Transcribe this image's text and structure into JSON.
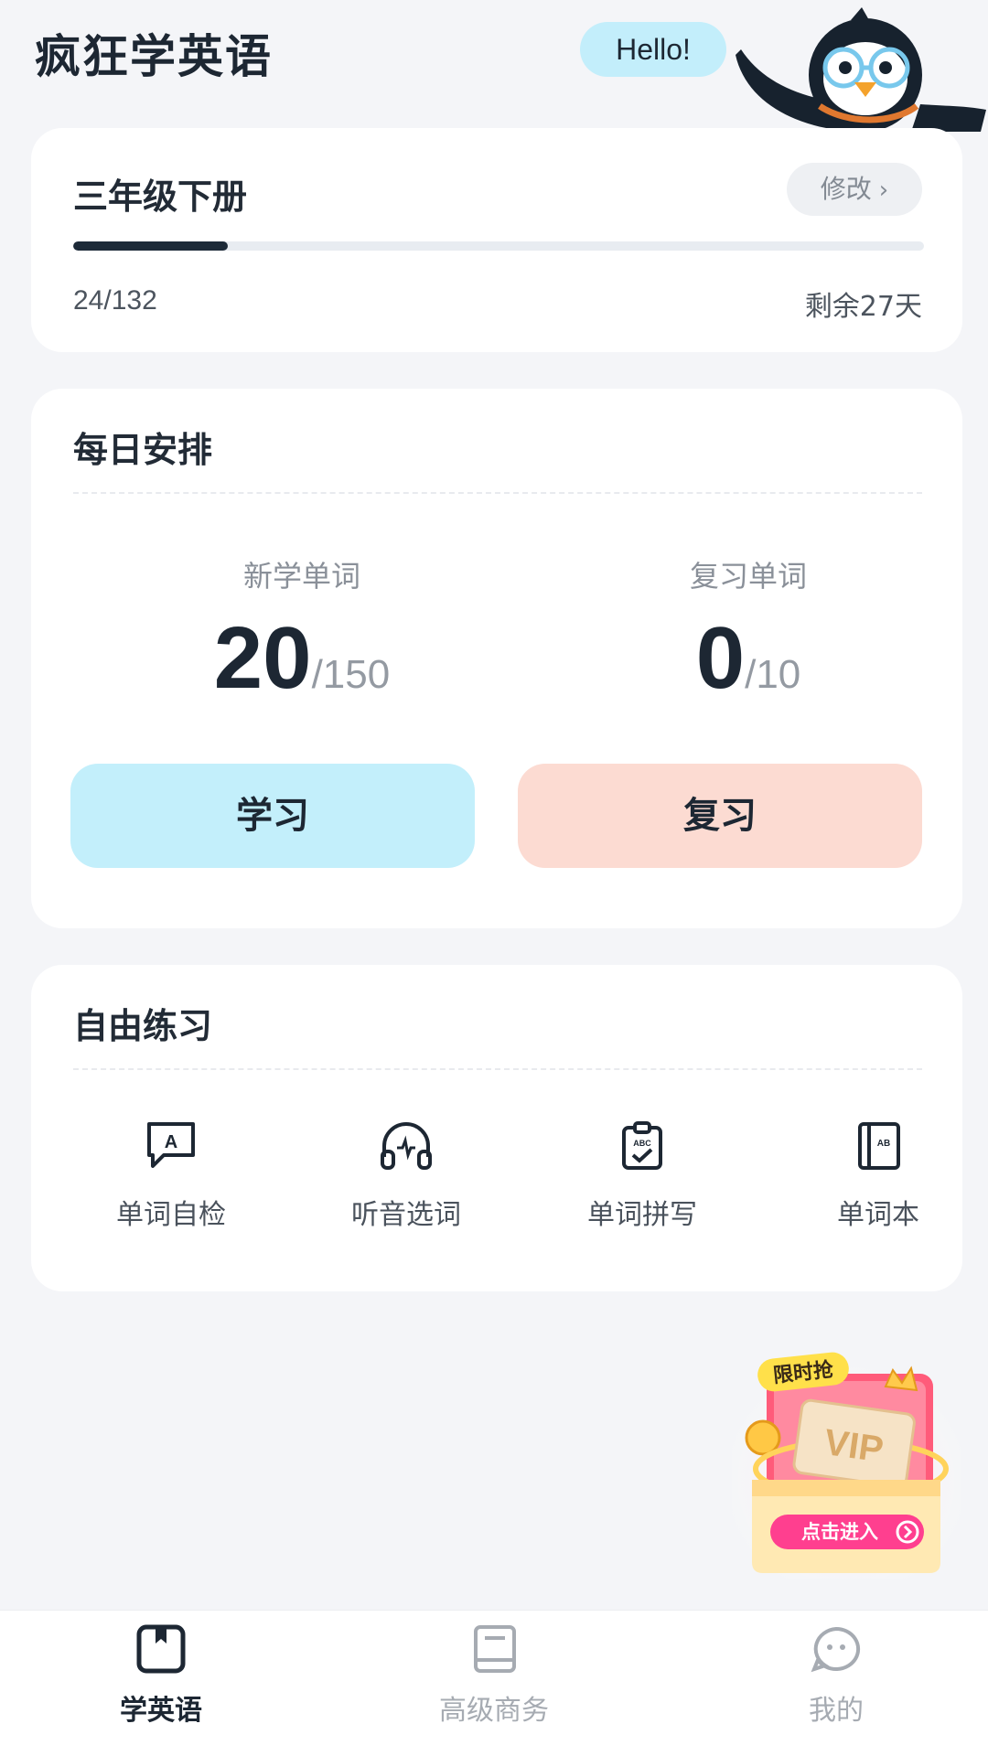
{
  "header": {
    "app_title": "疯狂学英语",
    "greeting": "Hello!"
  },
  "book": {
    "title": "三年级下册",
    "edit_label": "修改",
    "progress_text": "24/132",
    "progress_fraction": 0.182,
    "days_left": "剩余27天"
  },
  "daily": {
    "title": "每日安排",
    "new_words": {
      "label": "新学单词",
      "value": "20",
      "total": "/150",
      "accent": "#c3effb"
    },
    "review_words": {
      "label": "复习单词",
      "value": "0",
      "total": "/10",
      "accent": "#fcdbd2"
    },
    "study_button": "学习",
    "review_button": "复习"
  },
  "practice": {
    "title": "自由练习",
    "tools": [
      {
        "label": "单词自检",
        "icon": "word-check-icon"
      },
      {
        "label": "听音选词",
        "icon": "headphones-icon"
      },
      {
        "label": "单词拼写",
        "icon": "clipboard-spell-icon"
      },
      {
        "label": "单词本",
        "icon": "wordbook-icon"
      }
    ]
  },
  "promo": {
    "badge": "限时抢",
    "brand": "VIP",
    "cta": "点击进入"
  },
  "tabbar": {
    "items": [
      {
        "label": "学英语",
        "icon": "learn-icon",
        "active": true
      },
      {
        "label": "高级商务",
        "icon": "book-icon",
        "active": false
      },
      {
        "label": "我的",
        "icon": "profile-icon",
        "active": false
      }
    ]
  },
  "colors": {
    "primary_dark": "#1d2733",
    "study_accent": "#c3effb",
    "review_accent": "#fcdbd2",
    "background": "#f4f5f8"
  }
}
